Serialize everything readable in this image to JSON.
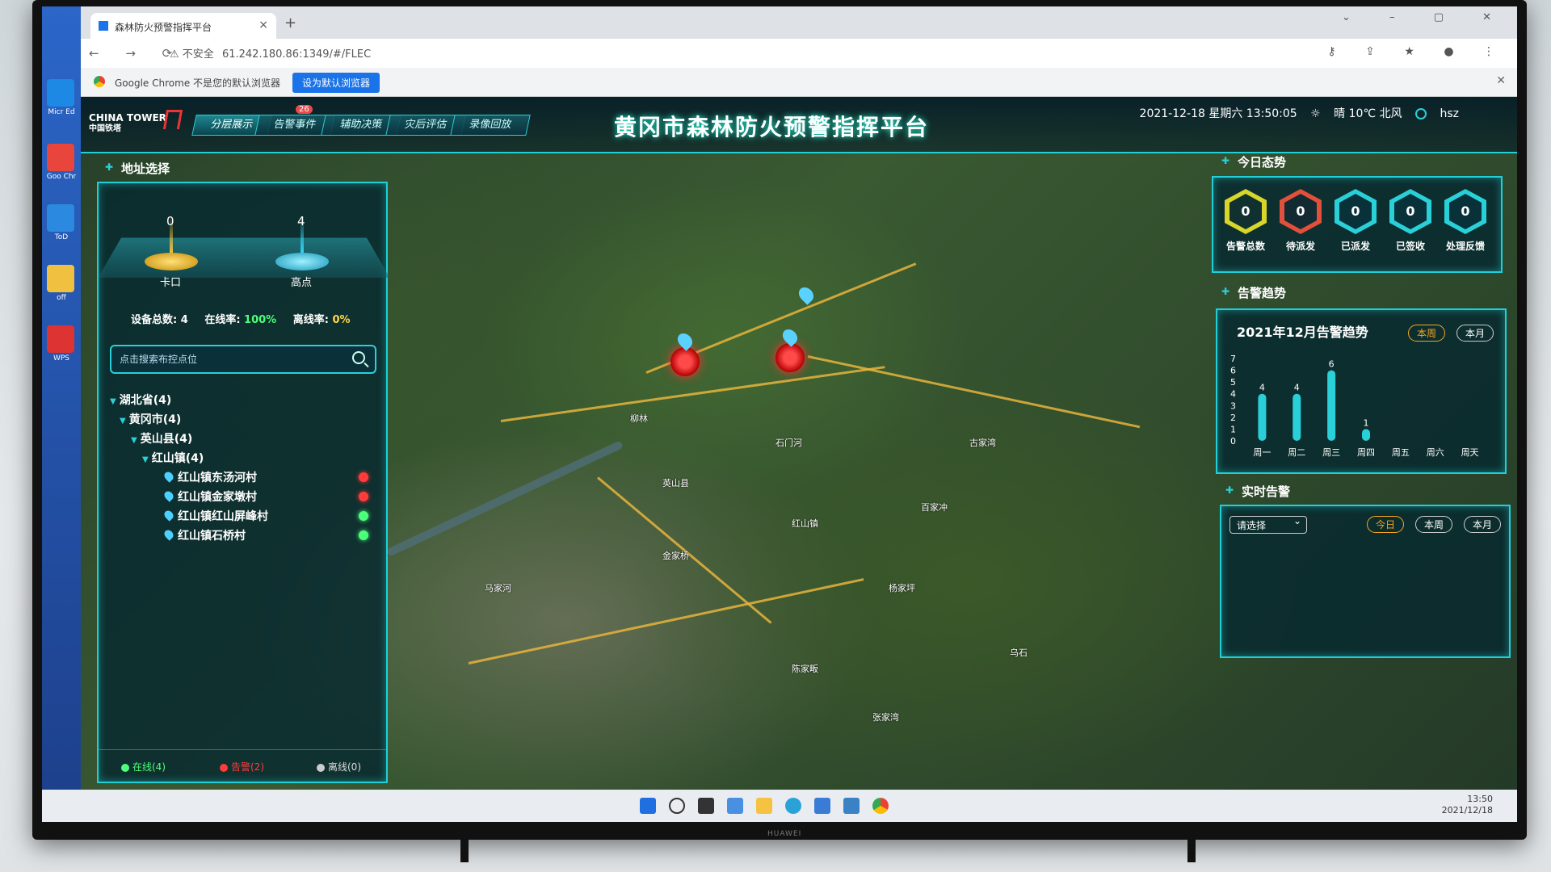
{
  "browser": {
    "tab_title": "森林防火预警指挥平台",
    "url_warning": "不安全",
    "url": "61.242.180.86:1349/#/FLEC",
    "infobar_msg": "Google Chrome 不是您的默认浏览器",
    "infobar_btn": "设为默认浏览器"
  },
  "desktop": {
    "icons": [
      "Micr Ed",
      "Goo Chr",
      "ToD",
      "off",
      "WPS"
    ]
  },
  "header": {
    "logo_line1": "CHINA TOWER",
    "logo_line2": "中国铁塔",
    "title": "黄冈市森林防火预警指挥平台",
    "nav": [
      {
        "label": "分层展示"
      },
      {
        "label": "告警事件"
      },
      {
        "label": "辅助决策"
      },
      {
        "label": "灾后评估"
      },
      {
        "label": "录像回放"
      }
    ],
    "badge": "26",
    "datetime": "2021-12-18 星期六 13:50:05",
    "weather": "晴 10℃ 北风",
    "user": "hsz"
  },
  "left": {
    "head": "地址选择",
    "gauges": [
      {
        "value": "0",
        "label": "卡口",
        "color": "#ffc83a"
      },
      {
        "value": "4",
        "label": "高点",
        "color": "#3ad8ff"
      }
    ],
    "stats": {
      "total_label": "设备总数:",
      "total": "4",
      "online_label": "在线率:",
      "online": "100%",
      "offline_label": "离线率:",
      "offline": "0%"
    },
    "search_placeholder": "点击搜索布控点位",
    "tree": [
      {
        "label": "湖北省(4)",
        "level": 0,
        "type": "node"
      },
      {
        "label": "黄冈市(4)",
        "level": 1,
        "type": "node"
      },
      {
        "label": "英山县(4)",
        "level": 2,
        "type": "node"
      },
      {
        "label": "红山镇(4)",
        "level": 3,
        "type": "node"
      },
      {
        "label": "红山镇东汤河村",
        "level": 4,
        "type": "leaf",
        "status": "alarm"
      },
      {
        "label": "红山镇金家墩村",
        "level": 4,
        "type": "leaf",
        "status": "alarm"
      },
      {
        "label": "红山镇红山屏峰村",
        "level": 4,
        "type": "leaf",
        "status": "online"
      },
      {
        "label": "红山镇石桥村",
        "level": 4,
        "type": "leaf",
        "status": "online"
      }
    ],
    "legend": [
      {
        "label": "在线(4)",
        "color": "#4cff7a"
      },
      {
        "label": "告警(2)",
        "color": "#ff3b3b"
      },
      {
        "label": "离线(0)",
        "color": "#cccccc"
      }
    ]
  },
  "right": {
    "today_head": "今日态势",
    "today": [
      {
        "value": "0",
        "label": "告警总数",
        "color": "#d8d62a"
      },
      {
        "value": "0",
        "label": "待派发",
        "color": "#e0503a"
      },
      {
        "value": "0",
        "label": "已派发",
        "color": "#2ad0d8"
      },
      {
        "value": "0",
        "label": "已签收",
        "color": "#2ad0d8"
      },
      {
        "value": "0",
        "label": "处理反馈",
        "color": "#2ad0d8"
      }
    ],
    "trend_head": "告警趋势",
    "trend_title": "2021年12月告警趋势",
    "trend_tabs": [
      "本周",
      "本月"
    ],
    "realtime_head": "实时告警",
    "realtime_select": "请选择",
    "realtime_tabs": [
      "今日",
      "本周",
      "本月"
    ]
  },
  "chart_data": {
    "type": "bar",
    "title": "2021年12月告警趋势",
    "categories": [
      "周一",
      "周二",
      "周三",
      "周四",
      "周五",
      "周六",
      "周天"
    ],
    "values": [
      4,
      4,
      6,
      1,
      0,
      0,
      0
    ],
    "y_ticks": [
      "7",
      "6",
      "5",
      "4",
      "3",
      "2",
      "1",
      "0"
    ],
    "ylim": [
      0,
      7
    ],
    "grid": false
  },
  "map": {
    "places": [
      "柳林",
      "英山县",
      "红山镇",
      "马家河",
      "金家桥",
      "杨家坪",
      "陈家畈",
      "百家冲",
      "乌石",
      "石门河",
      "古家湾",
      "张家湾"
    ]
  },
  "taskbar": {
    "time": "13:50",
    "date": "2021/12/18"
  }
}
